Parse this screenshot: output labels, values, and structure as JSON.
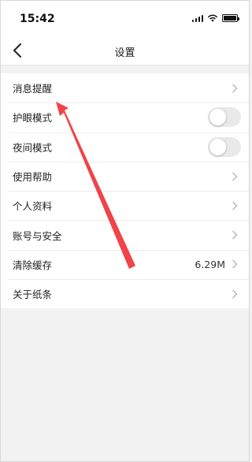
{
  "status_bar": {
    "time": "15:42",
    "icons": [
      "signal-icon",
      "wifi-icon",
      "battery-icon"
    ]
  },
  "nav": {
    "title": "设置",
    "back_icon": "chevron-left-icon"
  },
  "settings": [
    {
      "label": "消息提醒",
      "control": "chevron"
    },
    {
      "label": "护眼模式",
      "control": "toggle",
      "on": false
    },
    {
      "label": "夜间模式",
      "control": "toggle",
      "on": false
    },
    {
      "label": "使用帮助",
      "control": "chevron"
    },
    {
      "label": "个人资料",
      "control": "chevron"
    },
    {
      "label": "账号与安全",
      "control": "chevron"
    },
    {
      "label": "清除缓存",
      "control": "chevron",
      "value": "6.29M"
    },
    {
      "label": "关于纸条",
      "control": "chevron"
    }
  ],
  "colors": {
    "background": "#f2f2f2",
    "row_background": "#ffffff",
    "toggle_off": "#e9e9ea",
    "annotation_arrow": "#f0444a"
  }
}
